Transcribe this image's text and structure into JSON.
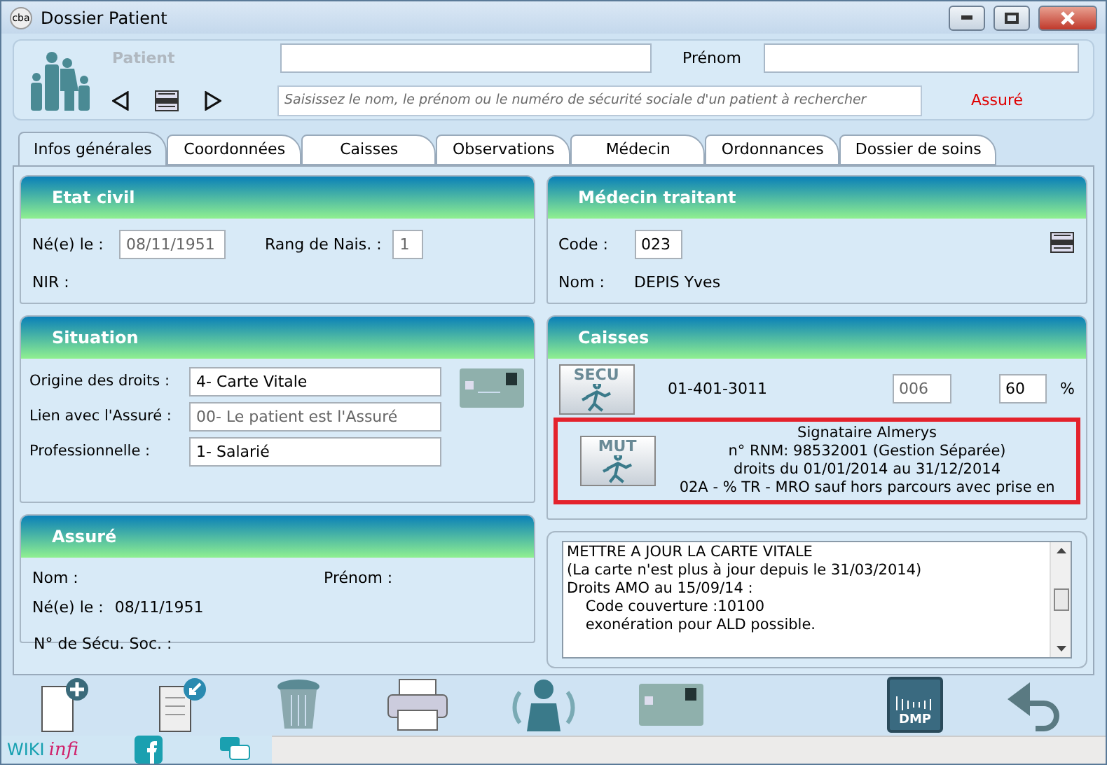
{
  "window": {
    "title": "Dossier Patient",
    "app_badge": "cba"
  },
  "header": {
    "patient_label": {
      "text": "Patient",
      "disabled": true
    },
    "prenom_label": "Prénom",
    "search_placeholder": "Saisissez le nom, le prénom ou le numéro de sécurité sociale d'un patient à rechercher",
    "status": "Assuré"
  },
  "tabs": [
    {
      "label": "Infos générales",
      "selected": true
    },
    {
      "label": "Coordonnées",
      "selected": false
    },
    {
      "label": "Caisses",
      "selected": false
    },
    {
      "label": "Observations",
      "selected": false
    },
    {
      "label": "Médecin",
      "selected": false
    },
    {
      "label": "Ordonnances",
      "selected": false
    },
    {
      "label": "Dossier de soins",
      "selected": false
    }
  ],
  "etat_civil": {
    "title": "Etat civil",
    "birth_label": "Né(e) le :",
    "birth_value": "08/11/1951",
    "rank_label": "Rang de Nais. :",
    "rank_value": "1",
    "nir_label": "NIR :"
  },
  "situation": {
    "title": "Situation",
    "fields": [
      {
        "label": "Origine des droits :",
        "value": "4- Carte Vitale",
        "disabled": false
      },
      {
        "label": "Lien avec l'Assuré :",
        "value": "00- Le patient est l'Assuré",
        "disabled": true
      },
      {
        "label": "Professionnelle :",
        "value": "1- Salarié",
        "disabled": false
      }
    ]
  },
  "assure": {
    "title": "Assuré",
    "nom_label": "Nom :",
    "prenom_label": "Prénom :",
    "birth_label": "Né(e) le :",
    "birth_value": "08/11/1951",
    "secu_label": "N° de Sécu. Soc. :"
  },
  "medecin": {
    "title": "Médecin traitant",
    "code_label": "Code :",
    "code_value": "023",
    "nom_label": "Nom :",
    "nom_value": "DEPIS Yves"
  },
  "caisses": {
    "title": "Caisses",
    "secu": {
      "badge": "SECU",
      "number": "01-401-3011",
      "centre": "006",
      "rate": "60",
      "unit": "%"
    },
    "mut": {
      "badge": "MUT",
      "lines": [
        "Signataire Almerys",
        "n° RNM: 98532001 (Gestion Séparée)",
        "droits du 01/01/2014 au 31/12/2014",
        "02A - % TR - MRO sauf hors parcours avec prise en"
      ]
    }
  },
  "notes": [
    "METTRE A JOUR LA CARTE VITALE",
    "(La carte n'est plus à jour depuis le 31/03/2014)",
    "Droits AMO au 15/09/14 :",
    "    Code couverture :10100",
    "    exonération pour ALD possible."
  ],
  "toolbar": {
    "dmp_label": "DMP"
  },
  "footer": {
    "wiki": "WIKI",
    "infi": "infi"
  }
}
